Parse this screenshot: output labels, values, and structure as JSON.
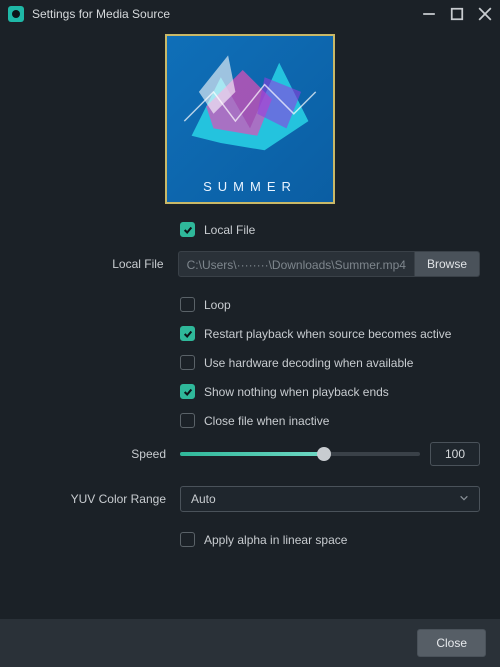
{
  "window": {
    "title": "Settings for Media Source"
  },
  "preview": {
    "caption": "SUMMER"
  },
  "fields": {
    "local_file_check": "Local File",
    "local_file_label": "Local File",
    "path_value": "C:\\Users\\········\\Downloads\\Summer.mp4",
    "browse": "Browse",
    "loop": "Loop",
    "restart": "Restart playback when source becomes active",
    "hw_decode": "Use hardware decoding when available",
    "show_nothing": "Show nothing when playback ends",
    "close_inactive": "Close file when inactive",
    "speed_label": "Speed",
    "speed_value": "100",
    "speed_percent": 60,
    "yuv_label": "YUV Color Range",
    "yuv_value": "Auto",
    "apply_alpha": "Apply alpha in linear space"
  },
  "footer": {
    "close": "Close"
  },
  "checked": {
    "local_file": true,
    "loop": false,
    "restart": true,
    "hw_decode": false,
    "show_nothing": true,
    "close_inactive": false,
    "apply_alpha": false
  }
}
